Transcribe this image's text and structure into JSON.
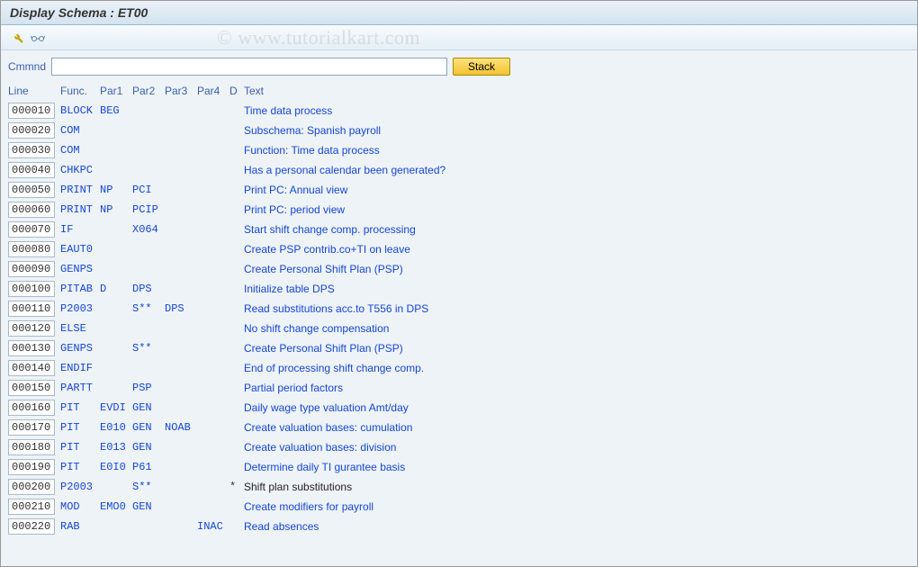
{
  "title": "Display Schema : ET00",
  "watermark": "© www.tutorialkart.com",
  "toolbar": {
    "icon1_name": "wrench-icon",
    "icon2_name": "glasses-icon"
  },
  "command": {
    "label": "Cmmnd",
    "value": "",
    "stack_label": "Stack"
  },
  "columns": {
    "line": "Line",
    "func": "Func.",
    "par1": "Par1",
    "par2": "Par2",
    "par3": "Par3",
    "par4": "Par4",
    "d": "D",
    "text": "Text"
  },
  "rows": [
    {
      "line": "000010",
      "func": "BLOCK",
      "par1": "BEG",
      "par2": "",
      "par3": "",
      "par4": "",
      "d": "",
      "text": "Time data process",
      "text_black": false
    },
    {
      "line": "000020",
      "func": "COM",
      "par1": "",
      "par2": "",
      "par3": "",
      "par4": "",
      "d": "",
      "text": "Subschema: Spanish payroll",
      "text_black": false
    },
    {
      "line": "000030",
      "func": "COM",
      "par1": "",
      "par2": "",
      "par3": "",
      "par4": "",
      "d": "",
      "text": "Function: Time data process",
      "text_black": false
    },
    {
      "line": "000040",
      "func": "CHKPC",
      "par1": "",
      "par2": "",
      "par3": "",
      "par4": "",
      "d": "",
      "text": "Has a personal calendar been generated?",
      "text_black": false
    },
    {
      "line": "000050",
      "func": "PRINT",
      "par1": "NP",
      "par2": "PCI",
      "par3": "",
      "par4": "",
      "d": "",
      "text": "Print PC: Annual view",
      "text_black": false
    },
    {
      "line": "000060",
      "func": "PRINT",
      "par1": "NP",
      "par2": "PCIP",
      "par3": "",
      "par4": "",
      "d": "",
      "text": "Print PC: period view",
      "text_black": false
    },
    {
      "line": "000070",
      "func": "IF",
      "par1": "",
      "par2": "X064",
      "par3": "",
      "par4": "",
      "d": "",
      "text": "Start shift change comp. processing",
      "text_black": false
    },
    {
      "line": "000080",
      "func": "EAUT0",
      "par1": "",
      "par2": "",
      "par3": "",
      "par4": "",
      "d": "",
      "text": "Create PSP contrib.co+TI on leave",
      "text_black": false
    },
    {
      "line": "000090",
      "func": "GENPS",
      "par1": "",
      "par2": "",
      "par3": "",
      "par4": "",
      "d": "",
      "text": "Create Personal Shift Plan (PSP)",
      "text_black": false
    },
    {
      "line": "000100",
      "func": "PITAB",
      "par1": "D",
      "par2": "DPS",
      "par3": "",
      "par4": "",
      "d": "",
      "text": "Initialize table DPS",
      "text_black": false
    },
    {
      "line": "000110",
      "func": "P2003",
      "par1": "",
      "par2": "S**",
      "par3": "DPS",
      "par4": "",
      "d": "",
      "text": "Read substitutions acc.to T556 in DPS",
      "text_black": false
    },
    {
      "line": "000120",
      "func": "ELSE",
      "par1": "",
      "par2": "",
      "par3": "",
      "par4": "",
      "d": "",
      "text": "No shift change compensation",
      "text_black": false
    },
    {
      "line": "000130",
      "func": "GENPS",
      "par1": "",
      "par2": "S**",
      "par3": "",
      "par4": "",
      "d": "",
      "text": "Create Personal Shift Plan (PSP)",
      "text_black": false
    },
    {
      "line": "000140",
      "func": "ENDIF",
      "par1": "",
      "par2": "",
      "par3": "",
      "par4": "",
      "d": "",
      "text": "End of processing shift change comp.",
      "text_black": false
    },
    {
      "line": "000150",
      "func": "PARTT",
      "par1": "",
      "par2": "PSP",
      "par3": "",
      "par4": "",
      "d": "",
      "text": "Partial period factors",
      "text_black": false
    },
    {
      "line": "000160",
      "func": "PIT",
      "par1": "EVDI",
      "par2": "GEN",
      "par3": "",
      "par4": "",
      "d": "",
      "text": "Daily wage type valuation Amt/day",
      "text_black": false
    },
    {
      "line": "000170",
      "func": "PIT",
      "par1": "E010",
      "par2": "GEN",
      "par3": "NOAB",
      "par4": "",
      "d": "",
      "text": "Create valuation bases: cumulation",
      "text_black": false
    },
    {
      "line": "000180",
      "func": "PIT",
      "par1": "E013",
      "par2": "GEN",
      "par3": "",
      "par4": "",
      "d": "",
      "text": "Create valuation bases: division",
      "text_black": false
    },
    {
      "line": "000190",
      "func": "PIT",
      "par1": "E0I0",
      "par2": "P61",
      "par3": "",
      "par4": "",
      "d": "",
      "text": "Determine daily TI gurantee basis",
      "text_black": false
    },
    {
      "line": "000200",
      "func": "P2003",
      "par1": "",
      "par2": "S**",
      "par3": "",
      "par4": "",
      "d": "*",
      "text": "Shift plan substitutions",
      "text_black": true
    },
    {
      "line": "000210",
      "func": "MOD",
      "par1": "EMO0",
      "par2": "GEN",
      "par3": "",
      "par4": "",
      "d": "",
      "text": "Create modifiers for payroll",
      "text_black": false
    },
    {
      "line": "000220",
      "func": "RAB",
      "par1": "",
      "par2": "",
      "par3": "",
      "par4": "INAC",
      "d": "",
      "text": "Read absences",
      "text_black": false
    }
  ]
}
